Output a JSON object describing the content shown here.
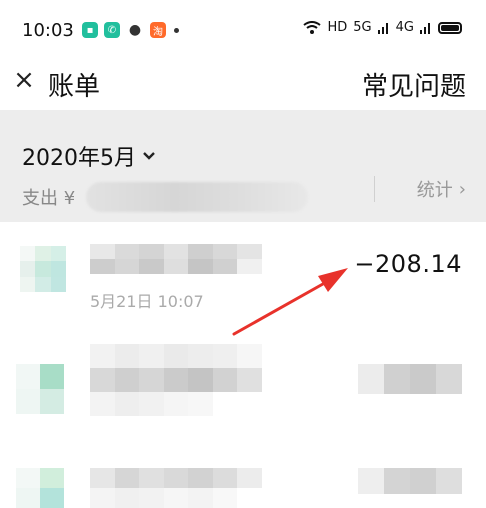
{
  "status_bar": {
    "time": "10:03",
    "network_label": "HD",
    "signal_1": "5G",
    "signal_2": "4G",
    "app_icons": [
      "teal-square-icon",
      "phone-icon",
      "wechat-icon",
      "taobao-icon"
    ]
  },
  "header": {
    "close_label": "×",
    "title": "账单",
    "faq_label": "常见问题"
  },
  "summary": {
    "month": "2020年5月",
    "expense_label": "支出 ¥",
    "stats_label": "统计",
    "stats_chevron": "›"
  },
  "transactions": [
    {
      "date": "5月21日 10:07",
      "amount": "−208.14"
    }
  ],
  "colors": {
    "summary_bg": "#ededed",
    "arrow": "#e8322b",
    "teal": "#21bf9d"
  }
}
